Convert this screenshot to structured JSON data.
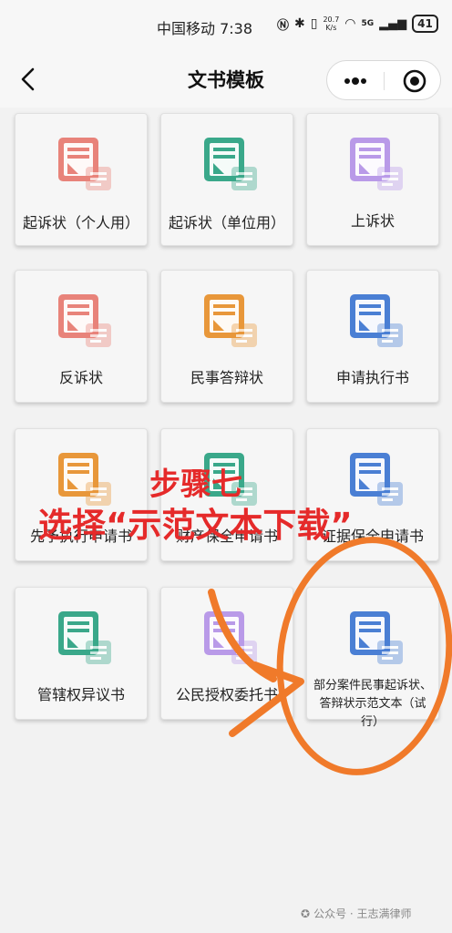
{
  "status_bar": {
    "carrier_time": "中国移动 7:38",
    "net_speed_value": "20.7",
    "net_speed_unit": "K/s",
    "signal_label": "5G",
    "battery": "41"
  },
  "nav": {
    "title": "文书模板"
  },
  "cards": [
    {
      "label": "起诉状（个人用）",
      "color": "#e8837a",
      "icon": "person-doc-icon"
    },
    {
      "label": "起诉状（单位用）",
      "color": "#3aa88a",
      "icon": "building-doc-icon"
    },
    {
      "label": "上诉状",
      "color": "#b99ae8",
      "icon": "scale-doc-icon"
    },
    {
      "label": "反诉状",
      "color": "#e8837a",
      "icon": "calendar-doc-icon"
    },
    {
      "label": "民事答辩状",
      "color": "#e8973a",
      "icon": "chat-doc-icon"
    },
    {
      "label": "申请执行书",
      "color": "#4a7fd4",
      "icon": "gavel-doc-icon"
    },
    {
      "label": "先予执行申请书",
      "color": "#e8973a",
      "icon": "forward-doc-icon"
    },
    {
      "label": "财产保全申请书",
      "color": "#3aa88a",
      "icon": "shield-doc-icon"
    },
    {
      "label": "证据保全申请书",
      "color": "#4a7fd4",
      "icon": "list-doc-icon"
    },
    {
      "label": "管辖权异议书",
      "color": "#3aa88a",
      "icon": "table-doc-icon"
    },
    {
      "label": "公民授权委托书",
      "color": "#b99ae8",
      "icon": "hand-doc-icon"
    },
    {
      "label": "部分案件民事起诉状、答辩状示范文本（试行）",
      "color": "#4a7fd4",
      "icon": "file-doc-icon"
    }
  ],
  "annotation": {
    "step": "步骤七",
    "instruction": "选择“示范文本下载”",
    "color": "#e52a2a",
    "circle_color": "#f07a2a"
  },
  "watermark": {
    "text": "公众号 · 王志满律师"
  }
}
